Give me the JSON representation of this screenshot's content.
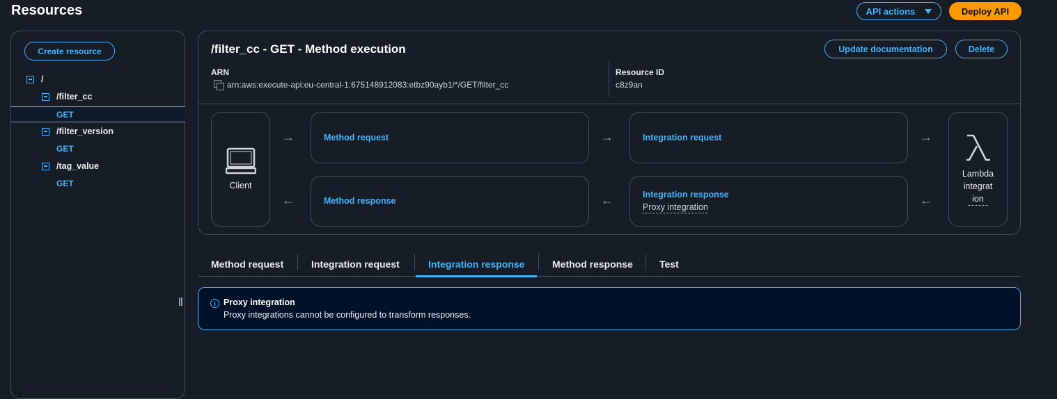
{
  "header": {
    "title": "Resources",
    "api_actions_label": "API actions",
    "deploy_api_label": "Deploy API"
  },
  "sidebar": {
    "create_resource_label": "Create resource",
    "tree": [
      {
        "label": "/",
        "type": "resource"
      },
      {
        "label": "/filter_cc",
        "type": "resource"
      },
      {
        "label": "GET",
        "type": "method",
        "selected": true
      },
      {
        "label": "/filter_version",
        "type": "resource"
      },
      {
        "label": "GET",
        "type": "method"
      },
      {
        "label": "/tag_value",
        "type": "resource"
      },
      {
        "label": "GET",
        "type": "method"
      }
    ]
  },
  "execution": {
    "title": "/filter_cc - GET - Method execution",
    "update_doc_label": "Update documentation",
    "delete_label": "Delete",
    "arn_label": "ARN",
    "arn_value": "arn:aws:execute-api:eu-central-1:675148912083:etbz90ayb1/*/GET/filter_cc",
    "resource_id_label": "Resource ID",
    "resource_id_value": "c8z9an",
    "flow": {
      "client_label": "Client",
      "method_request": "Method request",
      "integration_request": "Integration request",
      "method_response": "Method response",
      "integration_response": "Integration response",
      "integration_response_sub": "Proxy integration",
      "lambda_line1": "Lambda",
      "lambda_line2": "integrat",
      "lambda_line3": "ion"
    }
  },
  "tabs": [
    {
      "label": "Method request"
    },
    {
      "label": "Integration request"
    },
    {
      "label": "Integration response",
      "active": true
    },
    {
      "label": "Method response"
    },
    {
      "label": "Test"
    }
  ],
  "alert": {
    "title": "Proxy integration",
    "body": "Proxy integrations cannot be configured to transform responses."
  },
  "colors": {
    "background": "#161d26",
    "accent": "#42b4ff",
    "deploy": "#ff9900",
    "border": "#414d5c"
  }
}
